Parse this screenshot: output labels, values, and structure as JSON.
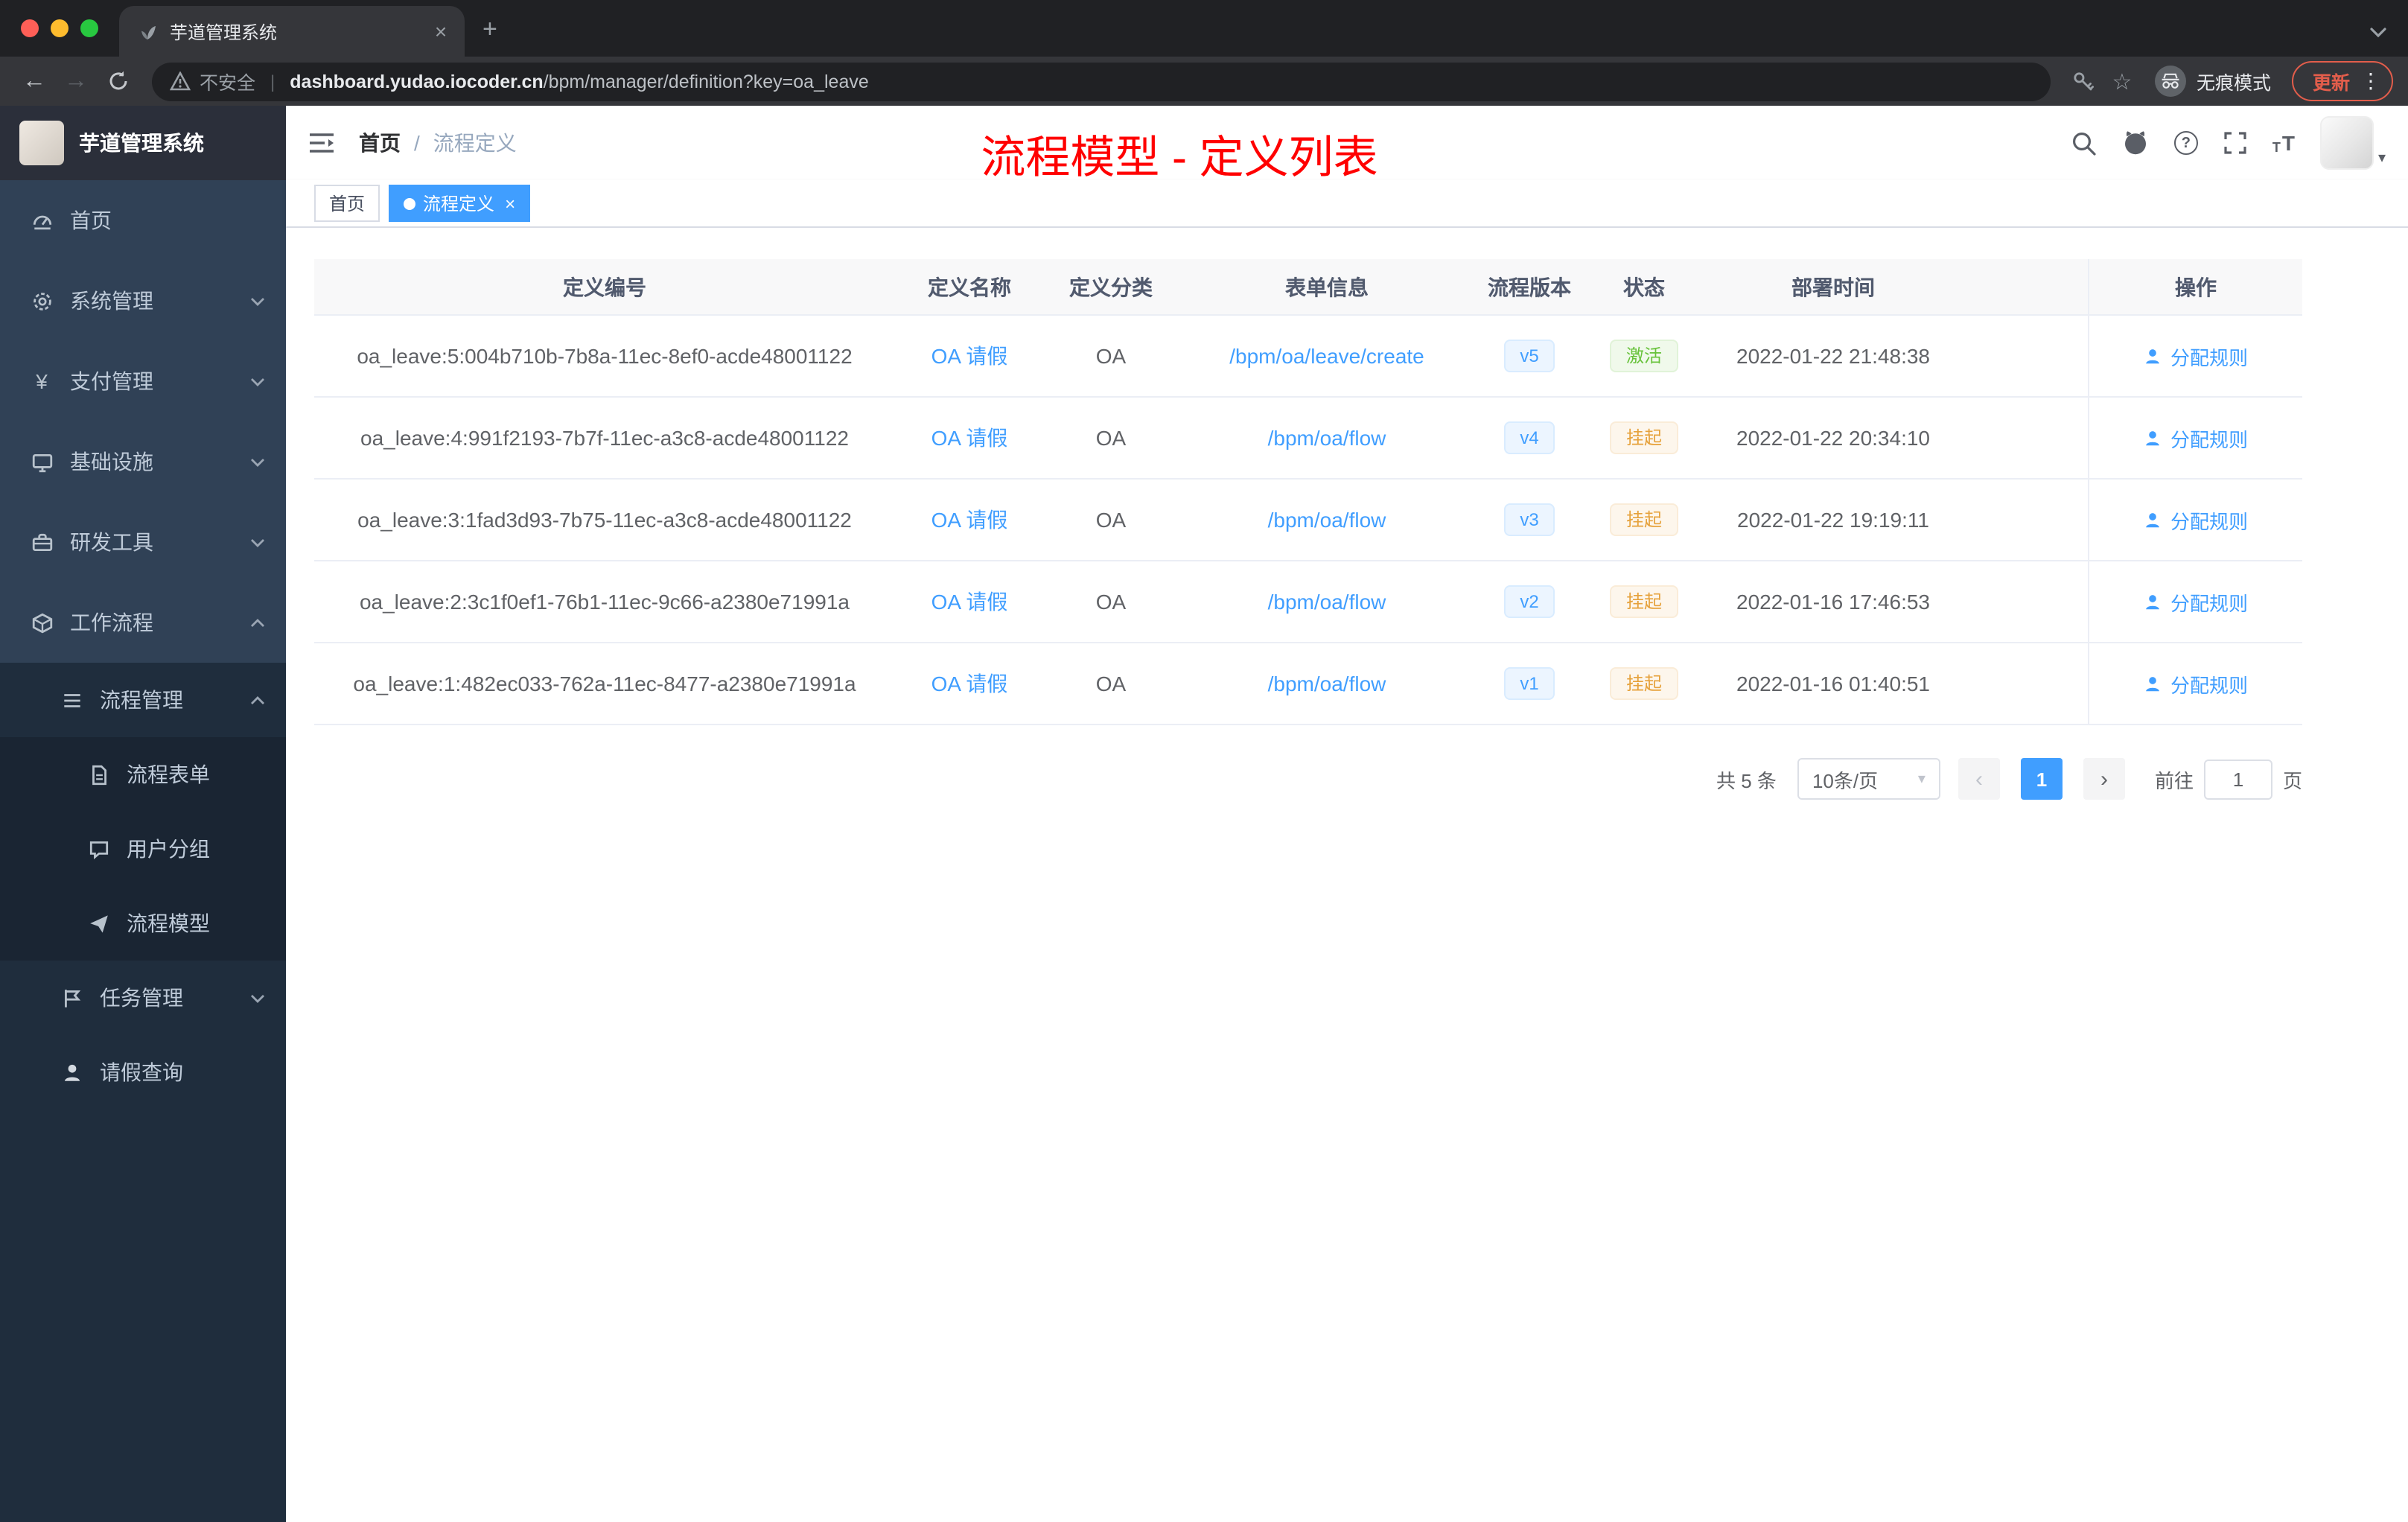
{
  "colors": {
    "accent": "#409eff",
    "success": "#67c23a",
    "warning": "#e6a23c",
    "annotation_red": "#ff0000",
    "sidebar_bg": "#304156",
    "submenu_bg": "#1f2d3d"
  },
  "icons": {
    "close": "×",
    "plus": "+",
    "back": "←",
    "forward": "→",
    "star": "☆",
    "kebab": "⋮",
    "caret_down": "▾",
    "divider": "|",
    "yen": "¥",
    "question": "?",
    "chevron_left": "‹",
    "chevron_right": "›",
    "size_small": "T",
    "size_big": "T"
  },
  "browser": {
    "tab": {
      "title": "芋道管理系统"
    },
    "address": {
      "security_label": "不安全",
      "url_domain": "dashboard.yudao.iocoder.cn",
      "url_path": "/bpm/manager/definition?key=oa_leave"
    },
    "profile_label": "无痕模式",
    "update_button": "更新"
  },
  "sidebar": {
    "logo_title": "芋道管理系统",
    "items": [
      {
        "label": "首页",
        "icon": "dashboard-icon",
        "level": 1
      },
      {
        "label": "系统管理",
        "icon": "gear-icon",
        "level": 1,
        "expanded": false
      },
      {
        "label": "支付管理",
        "icon": "yen-icon",
        "level": 1,
        "expanded": false
      },
      {
        "label": "基础设施",
        "icon": "monitor-icon",
        "level": 1,
        "expanded": false
      },
      {
        "label": "研发工具",
        "icon": "toolbox-icon",
        "level": 1,
        "expanded": false
      },
      {
        "label": "工作流程",
        "icon": "workflow-icon",
        "level": 1,
        "expanded": true
      },
      {
        "label": "流程管理",
        "icon": "list-icon",
        "level": 2,
        "expanded": true
      },
      {
        "label": "流程表单",
        "icon": "form-icon",
        "level": 3
      },
      {
        "label": "用户分组",
        "icon": "chat-icon",
        "level": 3
      },
      {
        "label": "流程模型",
        "icon": "send-icon",
        "level": 3
      },
      {
        "label": "任务管理",
        "icon": "task-icon",
        "level": 2,
        "expanded": false
      },
      {
        "label": "请假查询",
        "icon": "user-icon",
        "level": 2
      }
    ]
  },
  "header": {
    "breadcrumb": {
      "home": "首页",
      "separator": "/",
      "current": "流程定义"
    },
    "annotation": "流程模型 - 定义列表"
  },
  "tags": {
    "items": [
      {
        "label": "首页",
        "active": false
      },
      {
        "label": "流程定义",
        "active": true
      }
    ]
  },
  "table": {
    "columns": [
      "定义编号",
      "定义名称",
      "定义分类",
      "表单信息",
      "流程版本",
      "状态",
      "部署时间",
      "操作"
    ],
    "rows": [
      {
        "id": "oa_leave:5:004b710b-7b8a-11ec-8ef0-acde48001122",
        "name": "OA 请假",
        "category": "OA",
        "form": "/bpm/oa/leave/create",
        "version": "v5",
        "status": "激活",
        "status_type": "success",
        "deploy_time": "2022-01-22 21:48:38",
        "action": "分配规则"
      },
      {
        "id": "oa_leave:4:991f2193-7b7f-11ec-a3c8-acde48001122",
        "name": "OA 请假",
        "category": "OA",
        "form": "/bpm/oa/flow",
        "version": "v4",
        "status": "挂起",
        "status_type": "warning",
        "deploy_time": "2022-01-22 20:34:10",
        "action": "分配规则"
      },
      {
        "id": "oa_leave:3:1fad3d93-7b75-11ec-a3c8-acde48001122",
        "name": "OA 请假",
        "category": "OA",
        "form": "/bpm/oa/flow",
        "version": "v3",
        "status": "挂起",
        "status_type": "warning",
        "deploy_time": "2022-01-22 19:19:11",
        "action": "分配规则"
      },
      {
        "id": "oa_leave:2:3c1f0ef1-76b1-11ec-9c66-a2380e71991a",
        "name": "OA 请假",
        "category": "OA",
        "form": "/bpm/oa/flow",
        "version": "v2",
        "status": "挂起",
        "status_type": "warning",
        "deploy_time": "2022-01-16 17:46:53",
        "action": "分配规则"
      },
      {
        "id": "oa_leave:1:482ec033-762a-11ec-8477-a2380e71991a",
        "name": "OA 请假",
        "category": "OA",
        "form": "/bpm/oa/flow",
        "version": "v1",
        "status": "挂起",
        "status_type": "warning",
        "deploy_time": "2022-01-16 01:40:51",
        "action": "分配规则"
      }
    ]
  },
  "pagination": {
    "total": "共 5 条",
    "page_size": "10条/页",
    "page": "1",
    "goto_label": "前往",
    "goto_value": "1",
    "goto_unit": "页"
  }
}
